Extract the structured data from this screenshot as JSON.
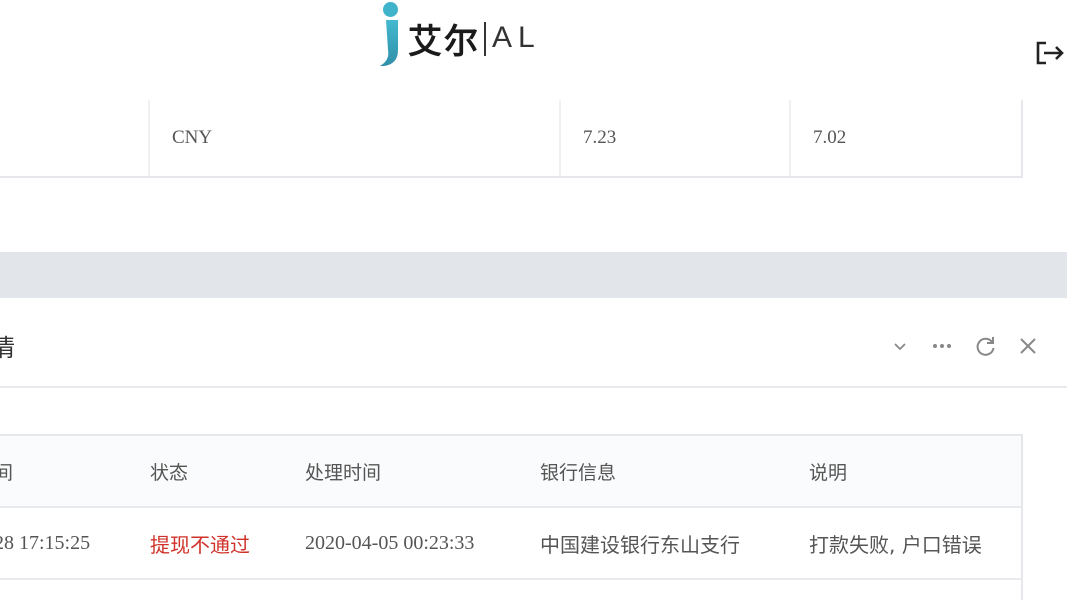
{
  "brand": {
    "logo_cn": "艾尔",
    "logo_en": "AL",
    "accent": "#3fb3c9"
  },
  "header": {
    "logout_icon": "logout-icon"
  },
  "rate_table": {
    "row": {
      "currency": "CNY",
      "rate1": "7.23",
      "rate2": "7.02"
    }
  },
  "panel": {
    "title_fragment": "情",
    "tools": [
      "chevron-down-icon",
      "more-icon",
      "refresh-icon",
      "close-icon"
    ]
  },
  "records": {
    "columns": {
      "time_fragment": "间",
      "status": "状态",
      "process_time": "处理时间",
      "bank_info": "银行信息",
      "remark": "说明"
    },
    "rows": [
      {
        "time_fragment": "28 17:15:25",
        "status": "提现不通过",
        "process_time": "2020-04-05 00:23:33",
        "bank_info": "中国建设银行东山支行",
        "remark": "打款失败, 户口错误"
      }
    ],
    "status_color": "#d0322a"
  }
}
